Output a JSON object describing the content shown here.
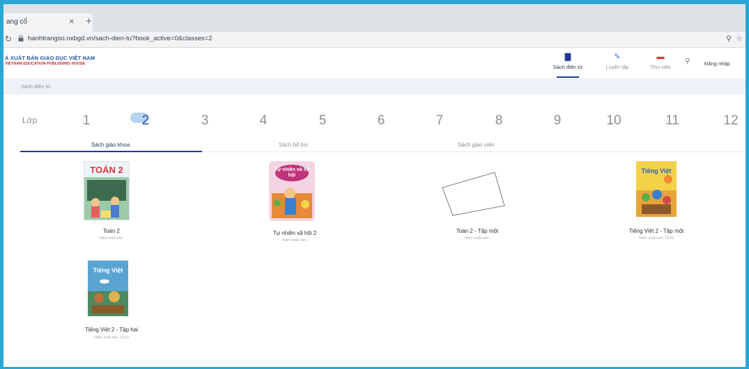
{
  "browser": {
    "tab_title": "ang cổ",
    "tab_close": "×",
    "new_tab": "+",
    "reload": "↻",
    "url": "hanhtrangso.nxbgd.vn/sach-dien-tu?book_active=0&classes=2",
    "zoom": "⚲",
    "bookmark": "☆"
  },
  "header": {
    "brand_line1": "Á XUẤT BẢN GIÁO DỤC VIỆT NAM",
    "brand_line2": "VIETNAM EDUCATION PUBLISHING HOUSE",
    "nav": [
      {
        "label": "Sách điện tử",
        "icon": "book-icon",
        "glyph": "▇",
        "color": "#1f3a93",
        "active": true
      },
      {
        "label": "Luyện tập",
        "icon": "pencil-icon",
        "glyph": "✎",
        "color": "#3f6fd8",
        "active": false
      },
      {
        "label": "Thư viện",
        "icon": "library-icon",
        "glyph": "▬",
        "color": "#d93636",
        "active": false
      }
    ],
    "search_glyph": "⚲",
    "login_label": "Đăng nhập"
  },
  "breadcrumb": "Sách điện tử",
  "grades": {
    "label": "Lớp",
    "items": [
      "1",
      "2",
      "3",
      "4",
      "5",
      "6",
      "7",
      "8",
      "9",
      "10",
      "11",
      "12"
    ],
    "selected": "2"
  },
  "categories": {
    "tabs": [
      "Sách giáo khoa",
      "Sách bổ trợ",
      "Sách giáo viên"
    ],
    "active": "Sách giáo khoa"
  },
  "books": [
    {
      "title": "Toán 2",
      "subtitle": "Năm xuất bản:",
      "cover_text": "TOÁN 2",
      "cover_color": "#e8f0f8"
    },
    {
      "title": "Tự nhiên xã hội 2",
      "subtitle": "Năm xuất bản:",
      "cover_text": "Tự nhiên và Xã hội",
      "cover_color": "#f6dfe9"
    },
    {
      "title": "Toán 2 - Tập một",
      "subtitle": "Năm xuất bản:",
      "cover_text": "",
      "cover_color": "#ffffff"
    },
    {
      "title": "Tiếng Việt 2 - Tập một",
      "subtitle": "Năm xuất bản: 2019",
      "cover_text": "Tiếng Việt",
      "cover_color": "#f3d24a"
    },
    {
      "title": "Tiếng Việt 2 - Tập hai",
      "subtitle": "Năm xuất bản: 2019",
      "cover_text": "Tiếng Việt",
      "cover_color": "#3f8fc4"
    }
  ]
}
